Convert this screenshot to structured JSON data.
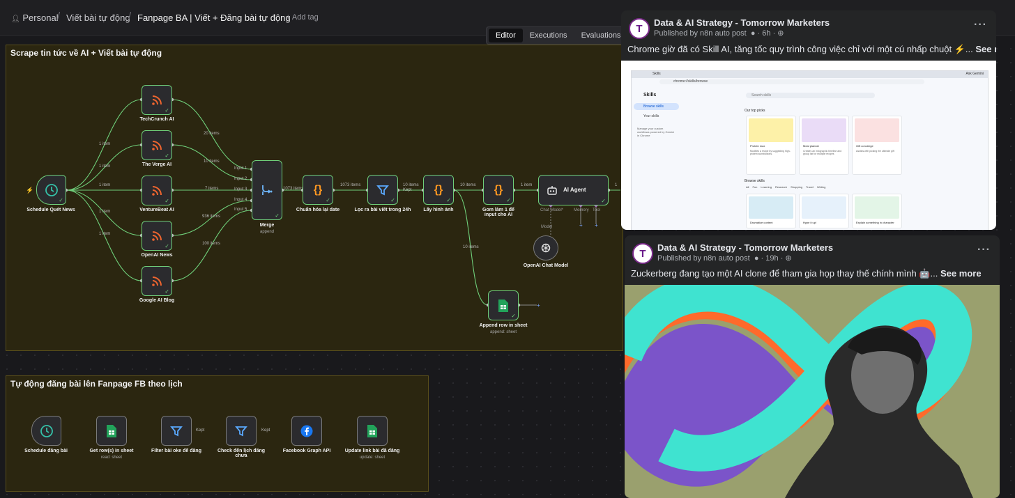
{
  "breadcrumb": {
    "personal": "Personal",
    "folder": "Viết bài tự động",
    "workflow": "Fanpage BA | Viết + Đăng bài tự động",
    "add_tag": "+ Add tag"
  },
  "tabs": {
    "editor": "Editor",
    "executions": "Executions",
    "evaluations": "Evaluations"
  },
  "section1": {
    "title": "Scrape tin tức về AI + Viết bài tự động",
    "nodes": {
      "schedule": "Schedule Quét News",
      "techcrunch": "TechCrunch AI",
      "verge": "The Verge AI",
      "venturebeat": "VentureBeat AI",
      "openai_news": "OpenAI News",
      "google_blog": "Google AI Blog",
      "merge": "Merge",
      "merge_sub": "append",
      "normalize_date": "Chuẩn hóa lại date",
      "filter24": "Lọc ra bài viết trong 24h",
      "get_image": "Lấy hình ảnh",
      "group_input": "Gom làm 1 để input cho AI",
      "ai_agent": "AI Agent",
      "chat_model_port": "Chat Model*",
      "memory_port": "Memory",
      "tool_port": "Tool",
      "model_label": "Model",
      "openai_chat": "OpenAI Chat Model",
      "append_row": "Append row in sheet",
      "append_sub": "append: sheet"
    },
    "edges": {
      "e1": "1 item",
      "e2": "1 item",
      "e3": "1 item",
      "e4": "1 item",
      "e5": "1 item",
      "tc": "20 items",
      "verge": "10 items",
      "vb": "7 items",
      "oa": "936 items",
      "gb": "100 items",
      "in1": "Input 1",
      "in2": "Input 2",
      "in3": "Input 3",
      "in4": "Input 4",
      "in5": "Input 5",
      "merge_out": "1073 items",
      "norm_out": "1073 items",
      "kept": "10 items",
      "kept_label": "Kept",
      "img_out": "10 items",
      "group_out": "1 item",
      "sheet_in": "10 items",
      "agent_out": "1"
    }
  },
  "section2": {
    "title": "Tự động đăng bài lên Fanpage FB theo lịch",
    "nodes": {
      "schedule": "Schedule đăng bài",
      "get_rows": "Get row(s) in sheet",
      "get_rows_sub": "read: sheet",
      "filter_ok": "Filter bài oke để đăng",
      "check_schedule": "Check đến lịch đăng chưa",
      "fb_api": "Facebook Graph API",
      "update_link": "Update link bài đã đăng",
      "update_sub": "update: sheet"
    },
    "edges": {
      "kept1": "Kept",
      "kept2": "Kept"
    }
  },
  "posts": [
    {
      "page": "Data & AI Strategy - Tomorrow Marketers",
      "published_by": "Published by n8n auto post",
      "time": "6h",
      "text": "Chrome giờ đã có Skill AI, tăng tốc quy trình công việc chỉ với một cú nhấp chuột ⚡...",
      "see_more": "See more",
      "image": {
        "address": "chrome://skills/browse",
        "tab": "Skills",
        "ask": "Ask Gemini",
        "heading": "Skills",
        "search": "Search skills",
        "nav1": "Browse skills",
        "nav2": "Your skills",
        "promo": "Manage your custom workflows powered by Gemini in Chrome",
        "top_picks": "Our top picks",
        "browse": "Browse skills",
        "cards": [
          {
            "title": "Protein max",
            "desc": "Modifies a recipe by suggesting high-protein substitutions.",
            "bg": "#fdf1a8"
          },
          {
            "title": "Meal planner",
            "desc": "Creates an infographic timeline and group list for multiple recipes",
            "bg": "#eadcf7"
          },
          {
            "title": "Gift concierge",
            "desc": "Assists with picking the ultimate gift",
            "bg": "#fbe1e1"
          }
        ],
        "chips": [
          "All",
          "Fun",
          "Learning",
          "Research",
          "Shopping",
          "Travel",
          "Writing"
        ],
        "bottom": [
          "Dramatize content",
          "Hype it up!",
          "Explain something in character"
        ]
      }
    },
    {
      "page": "Data & AI Strategy - Tomorrow Marketers",
      "published_by": "Published by n8n auto post",
      "time": "19h",
      "text": "Zuckerberg đang tạo một AI clone để tham gia họp thay thế chính mình 🤖...",
      "see_more": "See more"
    }
  ],
  "colors": {
    "node_border": "#6fcf7a",
    "sticky": "#2b2610",
    "fb_bg": "#242526"
  }
}
